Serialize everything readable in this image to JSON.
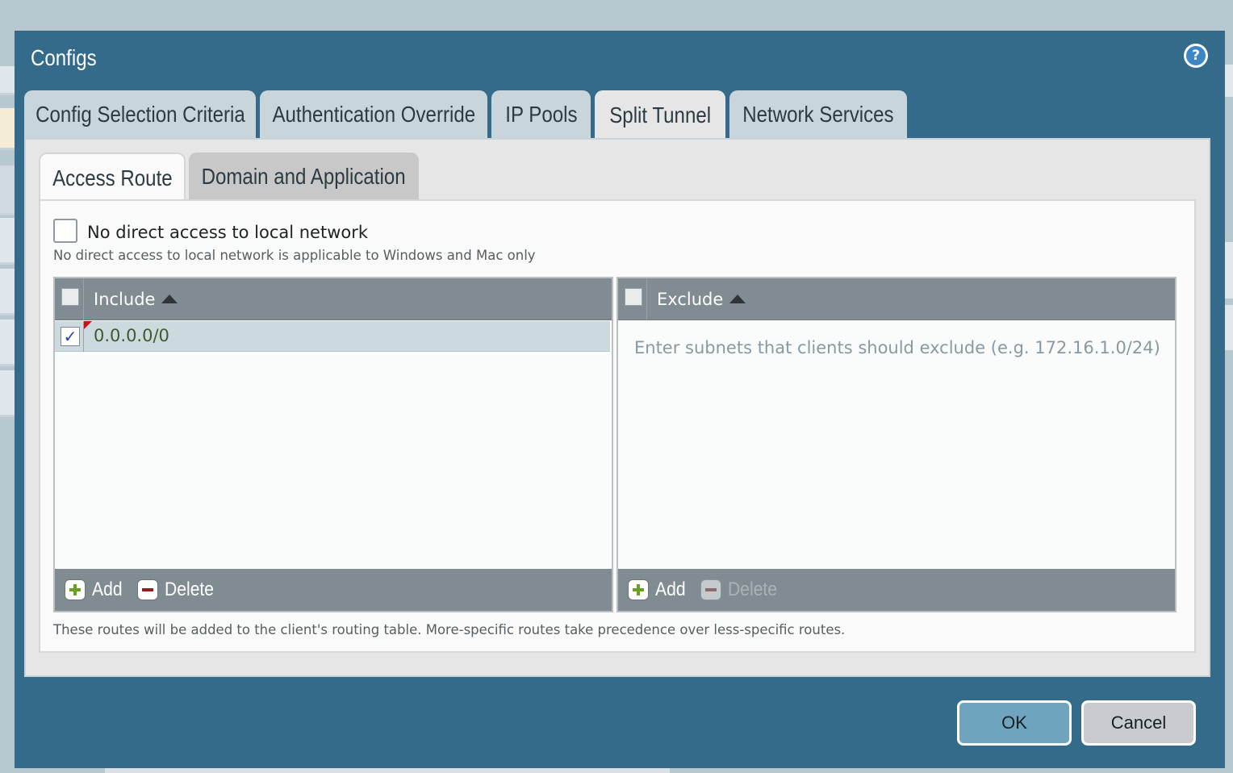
{
  "dialog": {
    "title": "Configs"
  },
  "tabs": [
    {
      "label": "Config Selection Criteria",
      "active": false
    },
    {
      "label": "Authentication Override",
      "active": false
    },
    {
      "label": "IP Pools",
      "active": false
    },
    {
      "label": "Split Tunnel",
      "active": true
    },
    {
      "label": "Network Services",
      "active": false
    }
  ],
  "subtabs": [
    {
      "label": "Access Route",
      "active": true
    },
    {
      "label": "Domain and Application",
      "active": false
    }
  ],
  "no_direct_access": {
    "label": "No direct access to local network",
    "checked": false,
    "hint": "No direct access to local network is applicable to Windows and Mac only"
  },
  "include_grid": {
    "header": "Include",
    "rows": [
      "0.0.0.0/0"
    ],
    "add_label": "Add",
    "delete_label": "Delete"
  },
  "exclude_grid": {
    "header": "Exclude",
    "placeholder": "Enter subnets that clients should exclude (e.g. 172.16.1.0/24)",
    "add_label": "Add",
    "delete_label": "Delete"
  },
  "footnote": "These routes will be added to the client's routing table. More-specific routes take precedence over less-specific routes.",
  "buttons": {
    "ok": "OK",
    "cancel": "Cancel"
  },
  "colors": {
    "dialog_bg": "#346b8a",
    "tab_bg": "#c8d5db",
    "grid_header": "#818b92",
    "ok_button": "#6fa4be"
  }
}
